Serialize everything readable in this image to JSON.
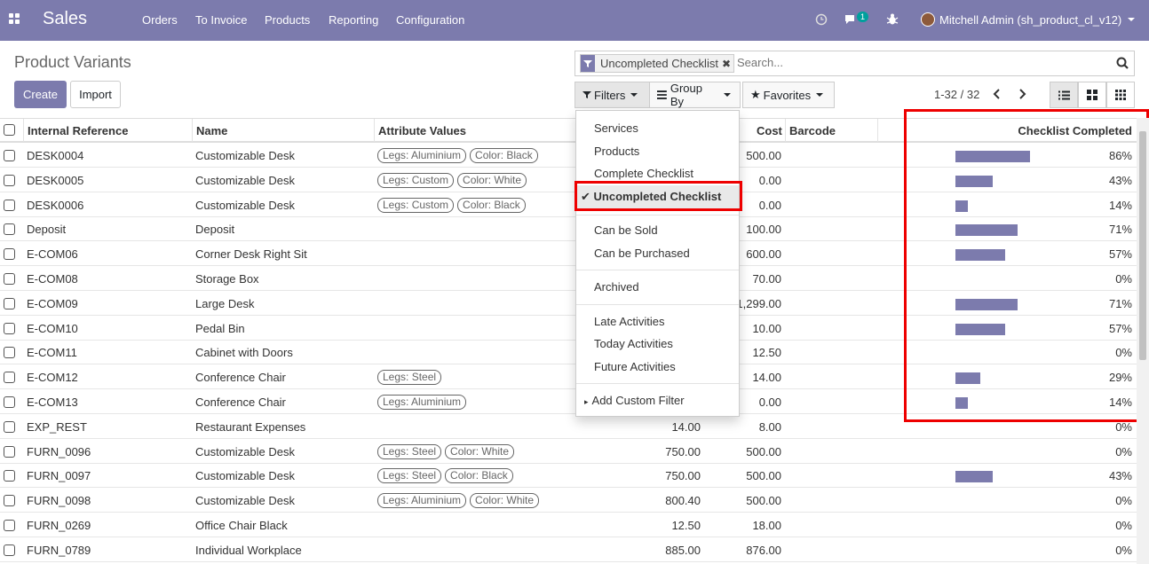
{
  "nav": {
    "brand": "Sales",
    "menu": [
      "Orders",
      "To Invoice",
      "Products",
      "Reporting",
      "Configuration"
    ],
    "chat_badge": "1",
    "user": "Mitchell Admin (sh_product_cl_v12)"
  },
  "page": {
    "title": "Product Variants",
    "create_label": "Create",
    "import_label": "Import"
  },
  "search": {
    "facet": "Uncompleted Checklist",
    "placeholder": "Search..."
  },
  "toolbar": {
    "filters": "Filters",
    "group_by": "Group By",
    "favorites": "Favorites",
    "pager": "1-32 / 32"
  },
  "columns": {
    "internal_reference": "Internal Reference",
    "name": "Name",
    "attribute_values": "Attribute Values",
    "cost": "Cost",
    "barcode": "Barcode",
    "checklist_completed": "Checklist Completed"
  },
  "filters_menu": {
    "services": "Services",
    "products": "Products",
    "complete_checklist": "Complete Checklist",
    "uncompleted_checklist": "Uncompleted Checklist",
    "can_be_sold": "Can be Sold",
    "can_be_purchased": "Can be Purchased",
    "archived": "Archived",
    "late_activities": "Late Activities",
    "today_activities": "Today Activities",
    "future_activities": "Future Activities",
    "add_custom_filter": "Add Custom Filter"
  },
  "colors": {
    "accent": "#7c7bad",
    "highlight": "#ee0000"
  },
  "rows": [
    {
      "ref": "DESK0004",
      "name": "Customizable Desk",
      "tags": [
        "Legs: Aluminium",
        "Color: Black"
      ],
      "price": "",
      "cost": "500.00",
      "pct": 86
    },
    {
      "ref": "DESK0005",
      "name": "Customizable Desk",
      "tags": [
        "Legs: Custom",
        "Color: White"
      ],
      "price": "",
      "cost": "0.00",
      "pct": 43
    },
    {
      "ref": "DESK0006",
      "name": "Customizable Desk",
      "tags": [
        "Legs: Custom",
        "Color: Black"
      ],
      "price": "",
      "cost": "0.00",
      "pct": 14
    },
    {
      "ref": "Deposit",
      "name": "Deposit",
      "tags": [],
      "price": "",
      "cost": "100.00",
      "pct": 71
    },
    {
      "ref": "E-COM06",
      "name": "Corner Desk Right Sit",
      "tags": [],
      "price": "",
      "cost": "600.00",
      "pct": 57
    },
    {
      "ref": "E-COM08",
      "name": "Storage Box",
      "tags": [],
      "price": "",
      "cost": "70.00",
      "pct": 0
    },
    {
      "ref": "E-COM09",
      "name": "Large Desk",
      "tags": [],
      "price": "",
      "cost": "1,299.00",
      "pct": 71
    },
    {
      "ref": "E-COM10",
      "name": "Pedal Bin",
      "tags": [],
      "price": "",
      "cost": "10.00",
      "pct": 57
    },
    {
      "ref": "E-COM11",
      "name": "Cabinet with Doors",
      "tags": [],
      "price": "",
      "cost": "12.50",
      "pct": 0
    },
    {
      "ref": "E-COM12",
      "name": "Conference Chair",
      "tags": [
        "Legs: Steel"
      ],
      "price": "",
      "cost": "14.00",
      "pct": 29
    },
    {
      "ref": "E-COM13",
      "name": "Conference Chair",
      "tags": [
        "Legs: Aluminium"
      ],
      "price": "",
      "cost": "0.00",
      "pct": 14
    },
    {
      "ref": "EXP_REST",
      "name": "Restaurant Expenses",
      "tags": [],
      "price": "14.00",
      "cost": "8.00",
      "pct": 0
    },
    {
      "ref": "FURN_0096",
      "name": "Customizable Desk",
      "tags": [
        "Legs: Steel",
        "Color: White"
      ],
      "price": "750.00",
      "cost": "500.00",
      "pct": 0
    },
    {
      "ref": "FURN_0097",
      "name": "Customizable Desk",
      "tags": [
        "Legs: Steel",
        "Color: Black"
      ],
      "price": "750.00",
      "cost": "500.00",
      "pct": 43
    },
    {
      "ref": "FURN_0098",
      "name": "Customizable Desk",
      "tags": [
        "Legs: Aluminium",
        "Color: White"
      ],
      "price": "800.40",
      "cost": "500.00",
      "pct": 0
    },
    {
      "ref": "FURN_0269",
      "name": "Office Chair Black",
      "tags": [],
      "price": "12.50",
      "cost": "18.00",
      "pct": 0
    },
    {
      "ref": "FURN_0789",
      "name": "Individual Workplace",
      "tags": [],
      "price": "885.00",
      "cost": "876.00",
      "pct": 0
    }
  ]
}
